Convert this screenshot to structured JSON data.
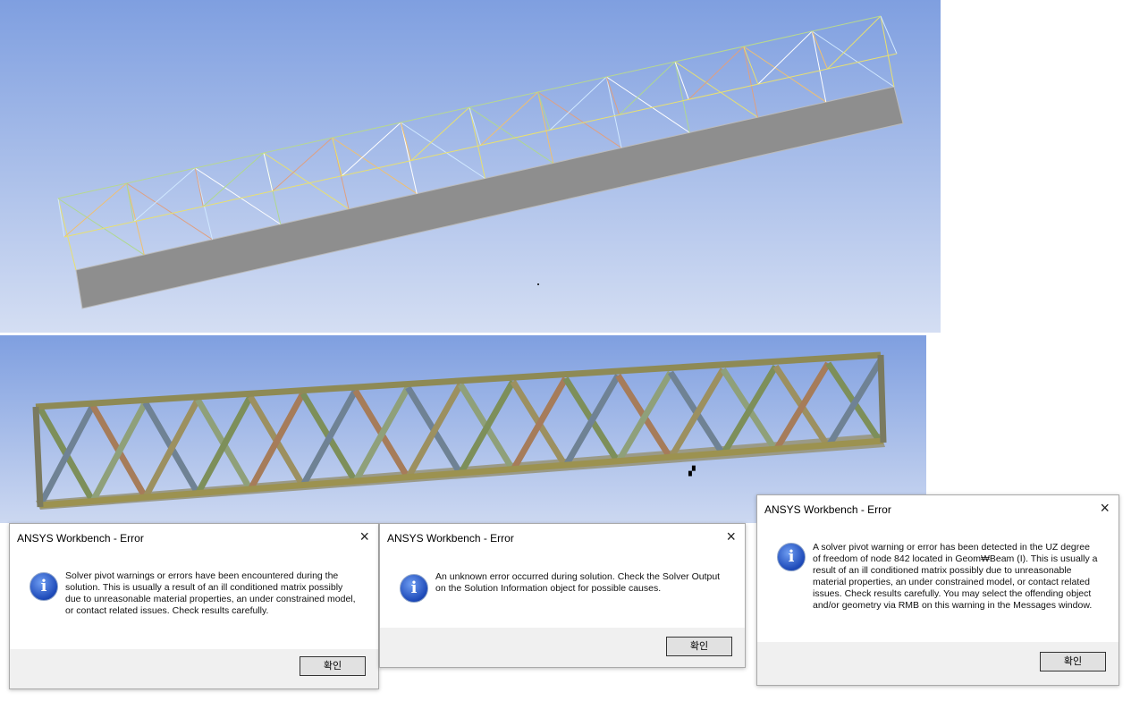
{
  "dialogs": [
    {
      "title": "ANSYS Workbench - Error",
      "message": "Solver pivot warnings or errors have been encountered during the solution.  This is usually a result of an ill conditioned matrix possibly due to unreasonable material properties, an under constrained model, or contact related issues.  Check results carefully.",
      "ok_label": "확인",
      "close_icon": "×"
    },
    {
      "title": "ANSYS Workbench - Error",
      "message": "An unknown error occurred during solution.  Check the Solver Output on the Solution Information object for possible causes.",
      "ok_label": "확인",
      "close_icon": "×"
    },
    {
      "title": "ANSYS Workbench - Error",
      "message": "A solver pivot warning or error has been detected in the UZ degree of freedom of node 842 located in Geom₩Beam (I).  This is usually a result of an ill conditioned matrix possibly due to unreasonable material properties, an under constrained model, or contact related issues.  Check results carefully. You may select the offending object and/or geometry via RMB on this warning in the Messages window.",
      "ok_label": "확인",
      "close_icon": "×"
    }
  ],
  "info_icon": "i"
}
